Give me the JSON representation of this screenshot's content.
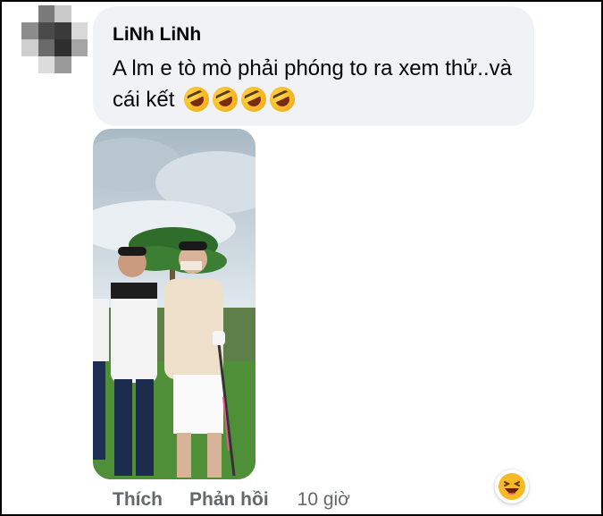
{
  "comment": {
    "author": "LiNh LiNh",
    "text": "A lm e tò mò phải phóng to ra xem thử..và cái kết",
    "emojis": [
      "rofl-emoji",
      "rofl-emoji",
      "rofl-emoji",
      "rofl-emoji"
    ]
  },
  "actions": {
    "like_label": "Thích",
    "reply_label": "Phản hồi",
    "timestamp": "10 giờ"
  },
  "reaction": {
    "icon": "laughing-emoji-icon"
  },
  "colors": {
    "bubble": "#f0f2f5",
    "text": "#050505",
    "muted": "#65676b"
  }
}
